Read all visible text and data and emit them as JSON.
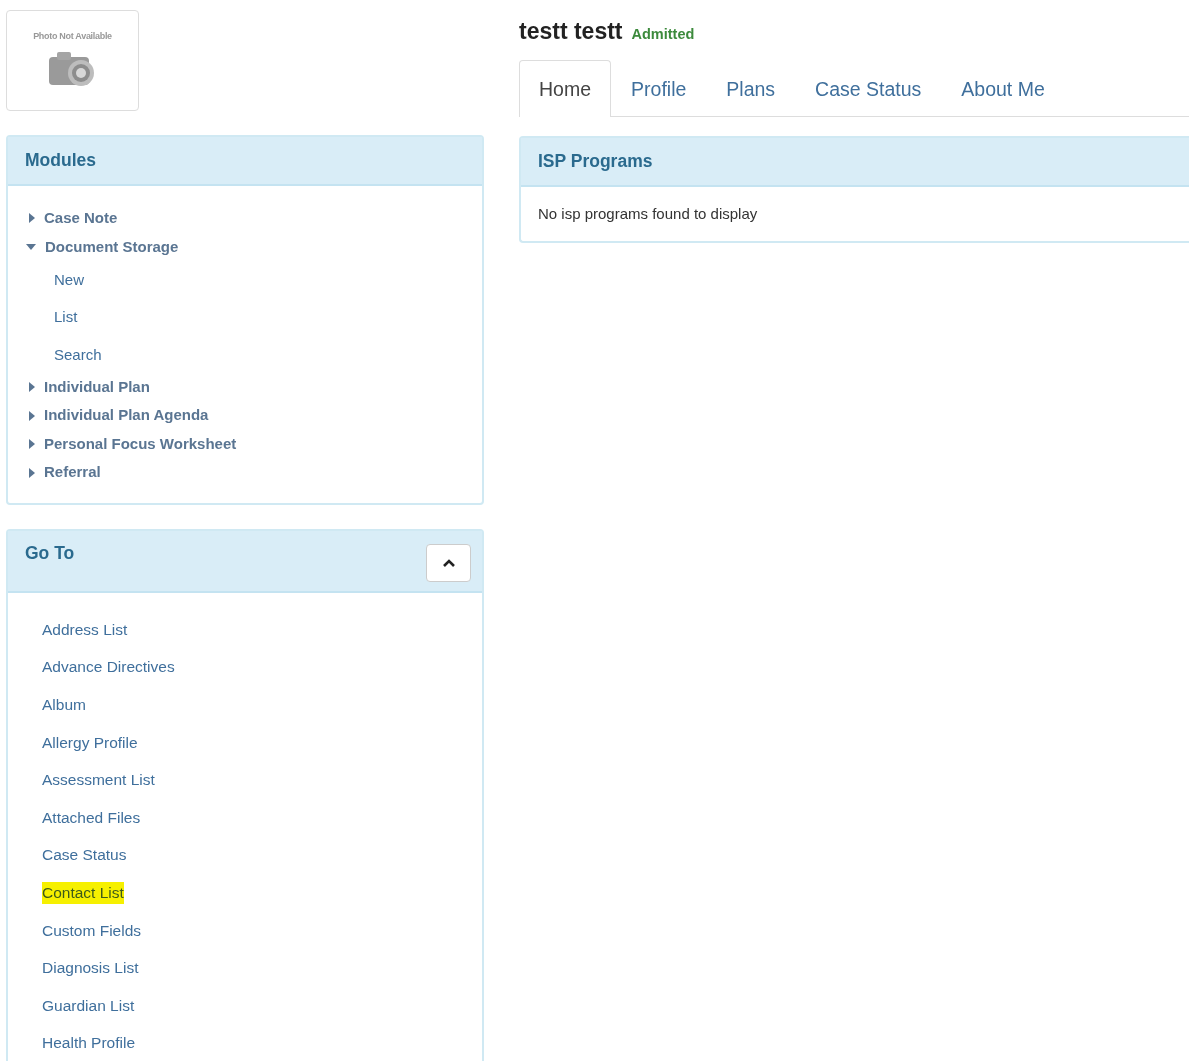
{
  "photo": {
    "caption": "Photo Not Available"
  },
  "patient": {
    "name": "testt testt",
    "status": "Admitted"
  },
  "tabs": [
    {
      "label": "Home",
      "selected": true
    },
    {
      "label": "Profile",
      "selected": false
    },
    {
      "label": "Plans",
      "selected": false
    },
    {
      "label": "Case Status",
      "selected": false
    },
    {
      "label": "About Me",
      "selected": false
    }
  ],
  "modules": {
    "title": "Modules",
    "items": [
      {
        "label": "Case Note",
        "expanded": false
      },
      {
        "label": "Document Storage",
        "expanded": true,
        "children": [
          {
            "label": "New"
          },
          {
            "label": "List"
          },
          {
            "label": "Search"
          }
        ]
      },
      {
        "label": "Individual Plan",
        "expanded": false
      },
      {
        "label": "Individual Plan Agenda",
        "expanded": false
      },
      {
        "label": "Personal Focus Worksheet",
        "expanded": false
      },
      {
        "label": "Referral",
        "expanded": false
      }
    ]
  },
  "go_to": {
    "title": "Go To",
    "expanded": true,
    "items": [
      {
        "label": "Address List",
        "highlighted": false
      },
      {
        "label": "Advance Directives",
        "highlighted": false
      },
      {
        "label": "Album",
        "highlighted": false
      },
      {
        "label": "Allergy Profile",
        "highlighted": false
      },
      {
        "label": "Assessment List",
        "highlighted": false
      },
      {
        "label": "Attached Files",
        "highlighted": false
      },
      {
        "label": "Case Status",
        "highlighted": false
      },
      {
        "label": "Contact List",
        "highlighted": true
      },
      {
        "label": "Custom Fields",
        "highlighted": false
      },
      {
        "label": "Diagnosis List",
        "highlighted": false
      },
      {
        "label": "Guardian List",
        "highlighted": false
      },
      {
        "label": "Health Profile",
        "highlighted": false
      }
    ]
  },
  "isp_programs": {
    "title": "ISP Programs",
    "message": "No isp programs found to display"
  }
}
